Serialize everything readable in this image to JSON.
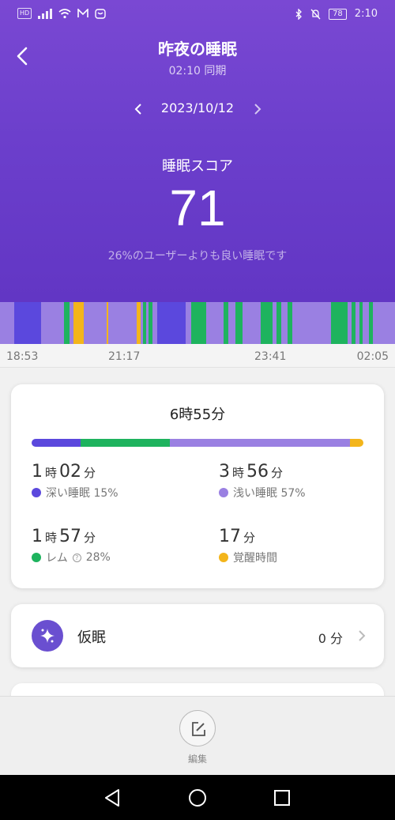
{
  "status_bar": {
    "hd": "HD",
    "battery": "78",
    "time": "2:10"
  },
  "header": {
    "title": "昨夜の睡眠",
    "sync": "02:10 同期",
    "date": "2023/10/12"
  },
  "score": {
    "label": "睡眠スコア",
    "value": "71",
    "compare": "26%のユーザーよりも良い睡眠です"
  },
  "timeline": {
    "axis_labels": [
      "18:53",
      "21:17",
      "23:41",
      "02:05"
    ],
    "colors": {
      "deep": "#5b48dd",
      "light": "#9a80e2",
      "rem": "#1eb35e",
      "awake": "#f3b51b",
      "background": "#9d86e4"
    },
    "segments": [
      {
        "stage": "light",
        "start": 0.0,
        "end": 0.036
      },
      {
        "stage": "deep",
        "start": 0.036,
        "end": 0.104
      },
      {
        "stage": "light",
        "start": 0.104,
        "end": 0.162
      },
      {
        "stage": "rem",
        "start": 0.162,
        "end": 0.176
      },
      {
        "stage": "light",
        "start": 0.176,
        "end": 0.186
      },
      {
        "stage": "awake",
        "start": 0.186,
        "end": 0.212
      },
      {
        "stage": "light",
        "start": 0.212,
        "end": 0.27
      },
      {
        "stage": "awake",
        "start": 0.27,
        "end": 0.274
      },
      {
        "stage": "light",
        "start": 0.274,
        "end": 0.346
      },
      {
        "stage": "awake",
        "start": 0.346,
        "end": 0.356
      },
      {
        "stage": "light",
        "start": 0.356,
        "end": 0.362
      },
      {
        "stage": "rem",
        "start": 0.362,
        "end": 0.37
      },
      {
        "stage": "light",
        "start": 0.37,
        "end": 0.376
      },
      {
        "stage": "rem",
        "start": 0.376,
        "end": 0.386
      },
      {
        "stage": "light",
        "start": 0.386,
        "end": 0.398
      },
      {
        "stage": "deep",
        "start": 0.398,
        "end": 0.47
      },
      {
        "stage": "light",
        "start": 0.47,
        "end": 0.484
      },
      {
        "stage": "rem",
        "start": 0.484,
        "end": 0.522
      },
      {
        "stage": "light",
        "start": 0.522,
        "end": 0.566
      },
      {
        "stage": "rem",
        "start": 0.566,
        "end": 0.578
      },
      {
        "stage": "light",
        "start": 0.578,
        "end": 0.596
      },
      {
        "stage": "rem",
        "start": 0.596,
        "end": 0.614
      },
      {
        "stage": "light",
        "start": 0.614,
        "end": 0.66
      },
      {
        "stage": "rem",
        "start": 0.66,
        "end": 0.69
      },
      {
        "stage": "light",
        "start": 0.69,
        "end": 0.7
      },
      {
        "stage": "rem",
        "start": 0.7,
        "end": 0.712
      },
      {
        "stage": "light",
        "start": 0.712,
        "end": 0.728
      },
      {
        "stage": "rem",
        "start": 0.728,
        "end": 0.74
      },
      {
        "stage": "light",
        "start": 0.74,
        "end": 0.838
      },
      {
        "stage": "rem",
        "start": 0.838,
        "end": 0.88
      },
      {
        "stage": "light",
        "start": 0.88,
        "end": 0.89
      },
      {
        "stage": "rem",
        "start": 0.89,
        "end": 0.9
      },
      {
        "stage": "light",
        "start": 0.9,
        "end": 0.91
      },
      {
        "stage": "rem",
        "start": 0.91,
        "end": 0.918
      },
      {
        "stage": "light",
        "start": 0.918,
        "end": 0.934
      },
      {
        "stage": "rem",
        "start": 0.934,
        "end": 0.944
      },
      {
        "stage": "light",
        "start": 0.944,
        "end": 1.0
      }
    ]
  },
  "summary": {
    "total": "6時55分",
    "bar": [
      {
        "stage": "deep",
        "fraction": 0.15
      },
      {
        "stage": "rem",
        "fraction": 0.27
      },
      {
        "stage": "light",
        "fraction": 0.55
      },
      {
        "stage": "awake",
        "fraction": 0.04
      }
    ],
    "stats": {
      "deep": {
        "h": "1",
        "h_unit": "時",
        "m": "02",
        "m_unit": "分",
        "label": "深い睡眠 15%"
      },
      "light": {
        "h": "3",
        "h_unit": "時",
        "m": "56",
        "m_unit": "分",
        "label": "浅い睡眠 57%"
      },
      "rem": {
        "h": "1",
        "h_unit": "時",
        "m": "57",
        "m_unit": "分",
        "label": "レム",
        "help": "?",
        "percent": "28%"
      },
      "awake": {
        "m": "17",
        "m_unit": "分",
        "label": "覚醒時間"
      }
    }
  },
  "nap": {
    "label": "仮眠",
    "value": "0 分"
  },
  "bottom": {
    "edit_label": "編集"
  }
}
